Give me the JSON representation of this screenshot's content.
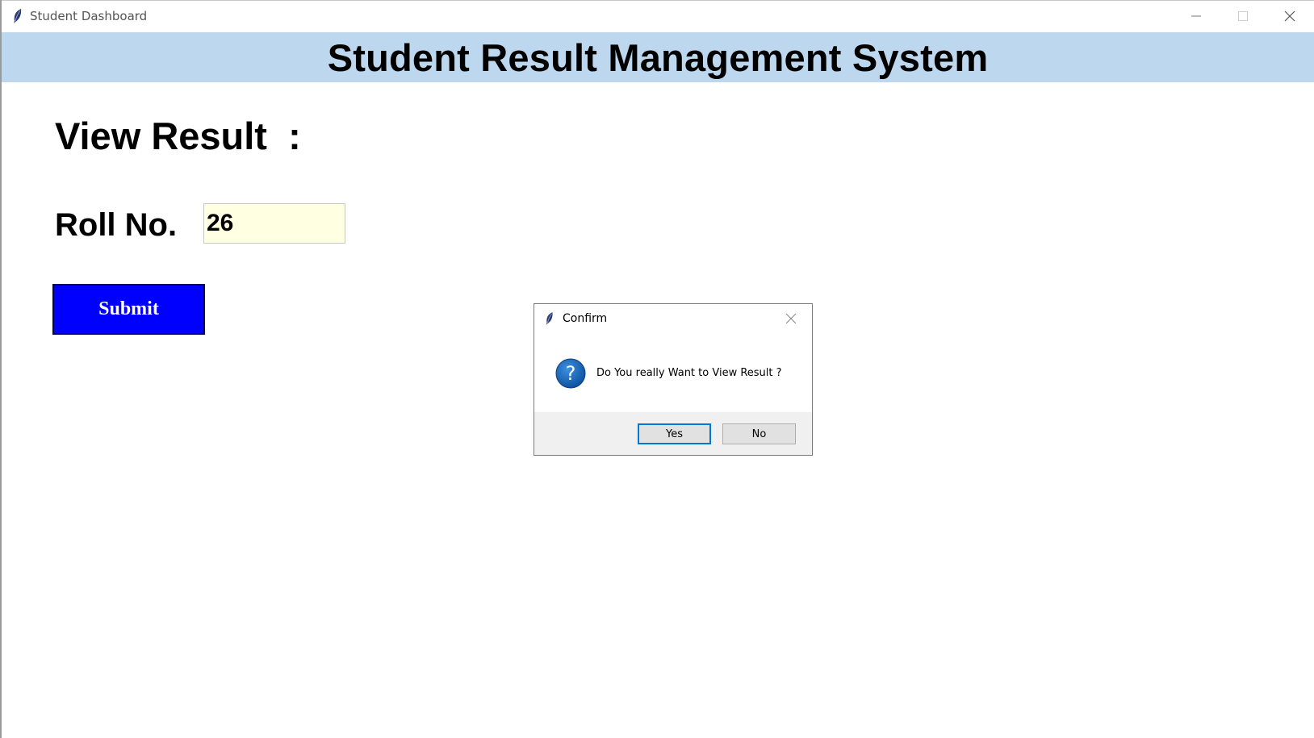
{
  "window": {
    "title": "Student Dashboard",
    "controls": [
      "minimize-icon",
      "maximize-icon",
      "close-icon"
    ]
  },
  "header": {
    "title": "Student Result Management System",
    "background_color": "#bdd7ee"
  },
  "main": {
    "section_title": "View Result  :",
    "roll_label": "Roll No.",
    "roll_value": "26",
    "roll_input_background": "#ffffe2",
    "submit_label": "Submit",
    "submit_color": "#0000ff"
  },
  "dialog": {
    "title": "Confirm",
    "icon": "question-icon",
    "message": "Do You really Want to View Result ?",
    "yes_label": "Yes",
    "no_label": "No",
    "default_button_color": "#0078d7"
  }
}
